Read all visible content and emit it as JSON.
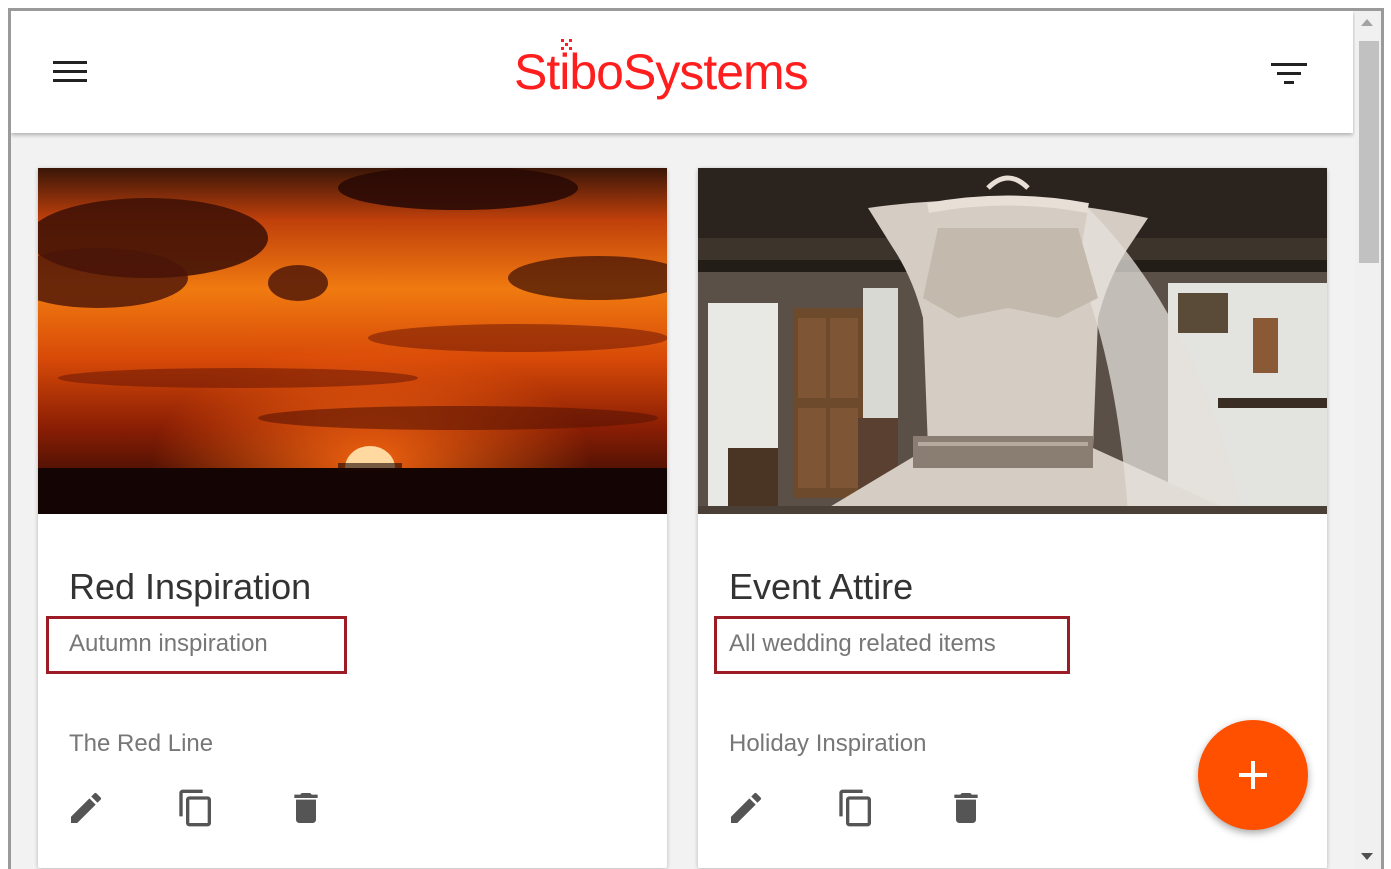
{
  "header": {
    "logo_text": "StiboSystems"
  },
  "cards": [
    {
      "image_alt": "sunset-photo",
      "title": "Red Inspiration",
      "subtitle": "Autumn inspiration",
      "owner": "The Red Line"
    },
    {
      "image_alt": "wedding-dress-photo",
      "title": "Event Attire",
      "subtitle": "All wedding related items",
      "owner": "Holiday Inspiration"
    }
  ],
  "colors": {
    "brand_red": "#ff1e1e",
    "fab_orange": "#ff5000",
    "highlight_border": "#9b1c24"
  },
  "icons": {
    "menu": "menu-icon",
    "filter": "filter-icon",
    "edit": "pencil-icon",
    "copy": "copy-icon",
    "delete": "trash-icon",
    "add": "plus-icon"
  }
}
